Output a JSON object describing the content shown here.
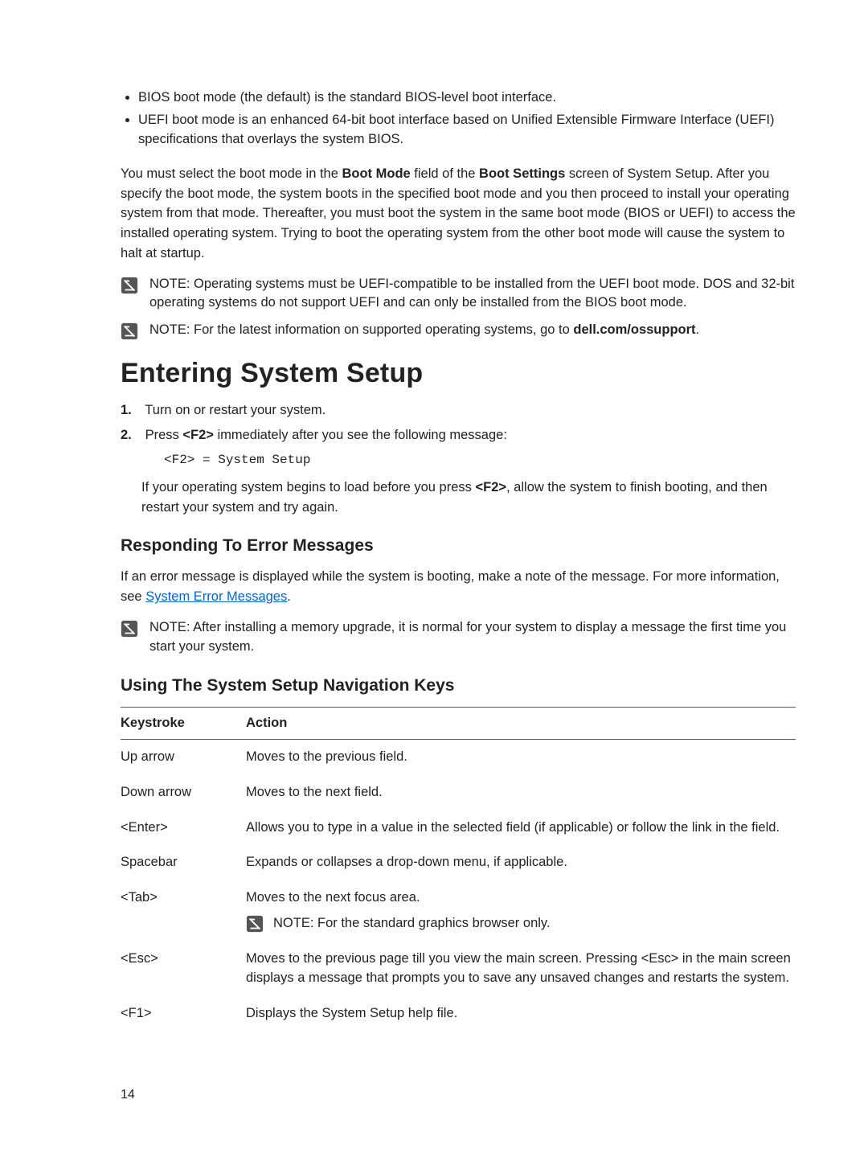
{
  "bullets": {
    "b1": "BIOS boot mode (the default) is the standard BIOS-level boot interface.",
    "b2": "UEFI boot mode is an enhanced 64-bit boot interface based on Unified Extensible Firmware Interface (UEFI) specifications that overlays the system BIOS."
  },
  "para_boot": {
    "pre": "You must select the boot mode in the ",
    "bootmode": "Boot Mode",
    "mid1": " field of the ",
    "bootsettings": "Boot Settings",
    "post": " screen of System Setup. After you specify the boot mode, the system boots in the specified boot mode and you then proceed to install your operating system from that mode. Thereafter, you must boot the system in the same boot mode (BIOS or UEFI) to access the installed operating system. Trying to boot the operating system from the other boot mode will cause the system to halt at startup."
  },
  "note1": {
    "label": "NOTE: ",
    "text": "Operating systems must be UEFI-compatible to be installed from the UEFI boot mode. DOS and 32-bit operating systems do not support UEFI and can only be installed from the BIOS boot mode."
  },
  "note2": {
    "label": "NOTE: ",
    "pre": "For the latest information on supported operating systems, go to ",
    "link": "dell.com/ossupport",
    "post": "."
  },
  "h1": "Entering System Setup",
  "steps": {
    "s1": "Turn on or restart your system.",
    "s2_pre": "Press ",
    "s2_key": "<F2>",
    "s2_post": " immediately after you see the following message:",
    "s2_mono": "<F2> = System Setup",
    "s2_sub_pre": "If your operating system begins to load before you press ",
    "s2_sub_key": "<F2>",
    "s2_sub_post": ", allow the system to finish booting, and then restart your system and try again."
  },
  "h2_err": "Responding To Error Messages",
  "err_para": {
    "pre": "If an error message is displayed while the system is booting, make a note of the message. For more information, see ",
    "link": "System Error Messages",
    "post": "."
  },
  "note3": {
    "label": "NOTE: ",
    "text": "After installing a memory upgrade, it is normal for your system to display a message the first time you start your system."
  },
  "h2_nav": "Using The System Setup Navigation Keys",
  "table": {
    "head_k": "Keystroke",
    "head_a": "Action",
    "rows": [
      {
        "k": "Up arrow",
        "a": "Moves to the previous field."
      },
      {
        "k": "Down arrow",
        "a": "Moves to the next field."
      },
      {
        "k": "<Enter>",
        "a": "Allows you to type in a value in the selected field (if applicable) or follow the link in the field."
      },
      {
        "k": "Spacebar",
        "a": "Expands or collapses a drop-down menu, if applicable."
      },
      {
        "k": "<Tab>",
        "a": "Moves to the next focus area."
      },
      {
        "k": "<Esc>",
        "a": "Moves to the previous page till you view the main screen. Pressing <Esc> in the main screen displays a message that prompts you to save any unsaved changes and restarts the system."
      },
      {
        "k": "<F1>",
        "a": "Displays the System Setup help file."
      }
    ],
    "tab_note_label": "NOTE: ",
    "tab_note_text": "For the standard graphics browser only."
  },
  "page_number": "14"
}
